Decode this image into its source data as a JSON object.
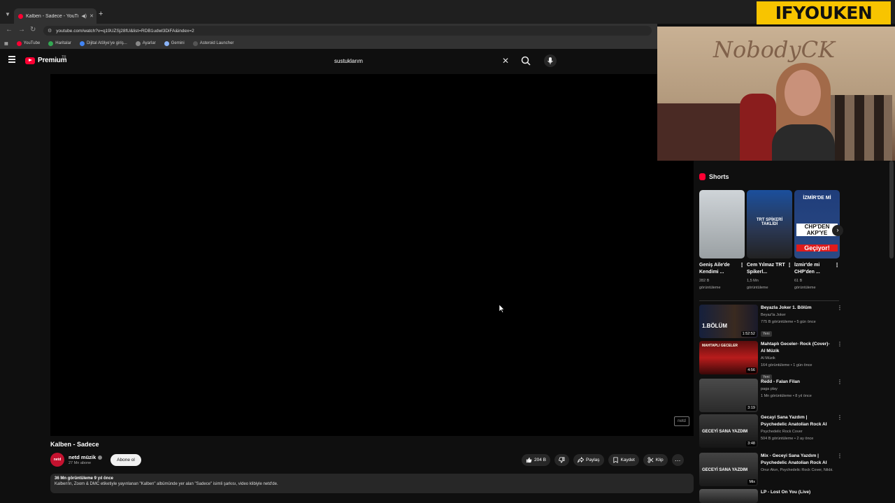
{
  "browser": {
    "tab_title": "Kalben - Sadece - YouTube",
    "url": "youtube.com/watch?v=q19UZSj28fU&list=RDB1udwl3DiFA&index=2",
    "bookmarks": [
      "YouTube",
      "Haritalar",
      "Dijital Atölye'ye giriş...",
      "Ayarlar",
      "Gemini",
      "Asteroid Launcher"
    ]
  },
  "youtube": {
    "logo_text": "Premium",
    "logo_region": "TR",
    "search_query": "sustuklarım"
  },
  "overlay": {
    "brand": "IFYOUKEN",
    "webcam_sign": "NobodyCK"
  },
  "player": {
    "watermark": "netd"
  },
  "video": {
    "title": "Kalben - Sadece",
    "channel_name": "netd müzik",
    "channel_avatar": "netd",
    "subscribers": "27 Mn abone",
    "subscribe_label": "Abone ol",
    "likes": "204 B",
    "share_label": "Paylaş",
    "save_label": "Kaydet",
    "clip_label": "Klip",
    "stats": "36 Mn görüntüleme  9 yıl önce",
    "description": "Kalben'in, Zoom & DMC etiketiyle yayınlanan \"Kalben\" albümünde yer alan \"Sadece\" isimli şarkısı, video klibiyle netd'de."
  },
  "sidebar": {
    "shorts_title": "Shorts",
    "shorts": [
      {
        "title": "Geniş Aile'de Kendimi ...",
        "views": "282 B",
        "views_suffix": "görüntüleme"
      },
      {
        "title": "Cem Yılmaz TRT Spikerl...",
        "views": "1,5 Mn",
        "views_suffix": "görüntüleme",
        "overlay": "TRT SPİKERİ TAKLİDİ"
      },
      {
        "title": "İzmir'de mi CHP'den ...",
        "views": "61 B",
        "views_suffix": "görüntüleme",
        "overlay_top": "İZMİR'DE Mİ",
        "overlay_mid": "CHP'DEN AKP'YE",
        "overlay_bottom": "Geçiyor!"
      }
    ],
    "recommendations": [
      {
        "title": "Beyazla Joker 1. Bölüm",
        "channel": "Beyaz'la Joker",
        "views": "775 B görüntüleme • 5 gün önce",
        "badge": "Yeni",
        "duration": "1:52:52",
        "thumb_text": "1.BÖLÜM"
      },
      {
        "title": "Mahtaplı Geceler- Rock (Cover)- Al Müzik",
        "channel": "Al Müzik",
        "views": "164 görüntüleme • 1 gün önce",
        "badge": "Yeni",
        "duration": "4:56",
        "thumb_text": "MAHTAPLI GECELER"
      },
      {
        "title": "Redd - Falan Filan",
        "channel": "paga play",
        "views": "1 Mn görüntüleme • 8 yıl önce",
        "badge": "",
        "duration": "3:19",
        "thumb_text": ""
      },
      {
        "title": "Gecayi Sana Yazdım | Psychedelic Anatolian Rock AI",
        "channel": "Psychedelic Rock Cover",
        "views": "504 B görüntüleme • 2 ay önce",
        "badge": "",
        "duration": "3:48",
        "thumb_text": "GECEYİ SANA YAZDIM"
      },
      {
        "title": "Mix - Geceyi Sana Yazdım | Psychedelic Anatolian Rock AI",
        "channel": "Onur Akın, Psychedelic Rock Cover, Nikbi...",
        "views": "",
        "badge": "",
        "duration": "Mix",
        "thumb_text": "GECEYİ SANA YAZDIM"
      },
      {
        "title": "LP - Lost On You (Live)",
        "channel": "",
        "views": "",
        "badge": "",
        "duration": "",
        "thumb_text": ""
      }
    ]
  },
  "colors": {
    "accent": "#ff0033",
    "overlay_yellow": "#f8c400",
    "background": "#0f0f0f"
  }
}
